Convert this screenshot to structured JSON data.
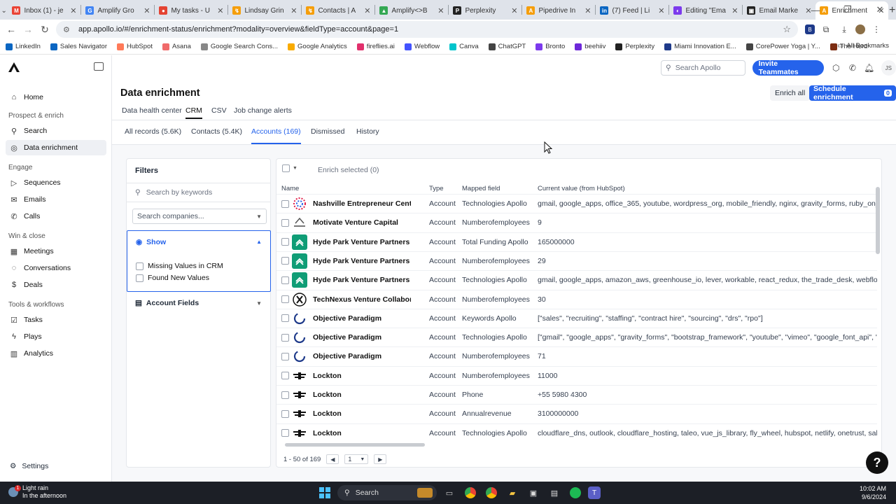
{
  "browser": {
    "tabs": [
      {
        "title": "Inbox (1) - je",
        "color": "#ea4335",
        "glyph": "M"
      },
      {
        "title": "Amplify Gro",
        "color": "#4285f4",
        "glyph": "G"
      },
      {
        "title": "My tasks - U",
        "color": "#e44332",
        "glyph": "●"
      },
      {
        "title": "Lindsay Grin",
        "color": "#f59e0b",
        "glyph": "↯"
      },
      {
        "title": "Contacts | A",
        "color": "#f59e0b",
        "glyph": "↯"
      },
      {
        "title": "Amplify<>B",
        "color": "#34a853",
        "glyph": "▲"
      },
      {
        "title": "Perplexity",
        "color": "#222",
        "glyph": "P"
      },
      {
        "title": "Pipedrive In",
        "color": "#f59e0b",
        "glyph": "A"
      },
      {
        "title": "(7) Feed | Li",
        "color": "#0a66c2",
        "glyph": "in"
      },
      {
        "title": "Editing \"Ema",
        "color": "#7c3aed",
        "glyph": "◐"
      },
      {
        "title": "Email Marke",
        "color": "#222",
        "glyph": "▣"
      },
      {
        "title": "Enrichment",
        "color": "#f59e0b",
        "glyph": "A"
      }
    ],
    "url": "app.apollo.io/#/enrichment-status/enrichment?modality=overview&fieldType=account&page=1",
    "bookmarks": [
      {
        "label": "LinkedIn",
        "color": "#0a66c2"
      },
      {
        "label": "Sales Navigator",
        "color": "#0a66c2"
      },
      {
        "label": "HubSpot",
        "color": "#ff7a59"
      },
      {
        "label": "Asana",
        "color": "#f06a6a"
      },
      {
        "label": "Google Search Cons...",
        "color": "#888888"
      },
      {
        "label": "Google Analytics",
        "color": "#f9ab00"
      },
      {
        "label": "fireflies.ai",
        "color": "#e1306c"
      },
      {
        "label": "Webflow",
        "color": "#4353ff"
      },
      {
        "label": "Canva",
        "color": "#00c4cc"
      },
      {
        "label": "ChatGPT",
        "color": "#444444"
      },
      {
        "label": "Bronto",
        "color": "#7c3aed"
      },
      {
        "label": "beehiiv",
        "color": "#6d28d9"
      },
      {
        "label": "Perplexity",
        "color": "#222222"
      },
      {
        "label": "Miami Innovation E...",
        "color": "#1e3a8a"
      },
      {
        "label": "CorePower Yoga | Y...",
        "color": "#444444"
      },
      {
        "label": "The Herd",
        "color": "#7c2d12"
      }
    ],
    "all_bookmarks": "All Bookmarks"
  },
  "sidebar": {
    "items": [
      {
        "label": "Home",
        "icon": "home-icon",
        "glyph": "⌂"
      },
      {
        "label": "Search",
        "icon": "search-icon",
        "glyph": "⚲"
      },
      {
        "label": "Data enrichment",
        "icon": "enrichment-icon",
        "glyph": "◎"
      },
      {
        "label": "Sequences",
        "icon": "sequences-icon",
        "glyph": "▷"
      },
      {
        "label": "Emails",
        "icon": "mail-icon",
        "glyph": "✉"
      },
      {
        "label": "Calls",
        "icon": "phone-icon",
        "glyph": "✆"
      },
      {
        "label": "Meetings",
        "icon": "calendar-icon",
        "glyph": "▦"
      },
      {
        "label": "Conversations",
        "icon": "chat-icon",
        "glyph": "◌"
      },
      {
        "label": "Deals",
        "icon": "dollar-icon",
        "glyph": "$"
      },
      {
        "label": "Tasks",
        "icon": "checkbox-icon",
        "glyph": "☑"
      },
      {
        "label": "Plays",
        "icon": "bolt-icon",
        "glyph": "ϟ"
      },
      {
        "label": "Analytics",
        "icon": "chart-icon",
        "glyph": "▥"
      }
    ],
    "sections": [
      "Prospect & enrich",
      "Engage",
      "Win & close",
      "Tools & workflows"
    ],
    "settings": "Settings"
  },
  "header": {
    "search_placeholder": "Search Apollo",
    "invite": "Invite Teammates",
    "avatar": "JS"
  },
  "page": {
    "title": "Data enrichment",
    "enrich_all": "Enrich all",
    "schedule": "Schedule enrichment",
    "schedule_badge": "0",
    "tabs": [
      "Data health center",
      "CRM",
      "CSV",
      "Job change alerts"
    ],
    "subtabs": [
      "All records (5.6K)",
      "Contacts (5.4K)",
      "Accounts (169)",
      "Dismissed",
      "History"
    ]
  },
  "filters": {
    "title": "Filters",
    "keyword_placeholder": "Search by keywords",
    "companies_placeholder": "Search companies...",
    "show_label": "Show",
    "options": [
      "Missing Values in CRM",
      "Found New Values"
    ],
    "account_fields": "Account Fields"
  },
  "table": {
    "enrich_selected": "Enrich selected (0)",
    "columns": [
      "Name",
      "Type",
      "Mapped field",
      "Current value (from HubSpot)"
    ],
    "rows": [
      {
        "name": "Nashville Entrepreneur Center",
        "type": "Account",
        "field": "Technologies Apollo",
        "value": "gmail, google_apps, office_365, youtube, wordpress_org, mobile_friendly, nginx, gravity_forms, ruby_on_rails, google_",
        "logo": "dots"
      },
      {
        "name": "Motivate Venture Capital",
        "type": "Account",
        "field": "Numberofemployees",
        "value": "9",
        "logo": "mvc"
      },
      {
        "name": "Hyde Park Venture Partners",
        "type": "Account",
        "field": "Total Funding Apollo",
        "value": "165000000",
        "logo": "hp"
      },
      {
        "name": "Hyde Park Venture Partners",
        "type": "Account",
        "field": "Numberofemployees",
        "value": "29",
        "logo": "hp"
      },
      {
        "name": "Hyde Park Venture Partners",
        "type": "Account",
        "field": "Technologies Apollo",
        "value": "gmail, google_apps, amazon_aws, greenhouse_io, lever, workable, react_redux, the_trade_desk, webflow, nginx, braint",
        "logo": "hp"
      },
      {
        "name": "TechNexus Venture Collabora...",
        "type": "Account",
        "field": "Numberofemployees",
        "value": "30",
        "logo": "x"
      },
      {
        "name": "Objective Paradigm",
        "type": "Account",
        "field": "Keywords Apollo",
        "value": "[\"sales\", \"recruiting\", \"staffing\", \"contract hire\", \"sourcing\", \"drs\", \"rpo\"]",
        "logo": "op"
      },
      {
        "name": "Objective Paradigm",
        "type": "Account",
        "field": "Technologies Apollo",
        "value": "[\"gmail\", \"google_apps\", \"gravity_forms\", \"bootstrap_framework\", \"youtube\", \"vimeo\", \"google_font_api\", \"google_tag",
        "logo": "op"
      },
      {
        "name": "Objective Paradigm",
        "type": "Account",
        "field": "Numberofemployees",
        "value": "71",
        "logo": "op"
      },
      {
        "name": "Lockton",
        "type": "Account",
        "field": "Numberofemployees",
        "value": "11000",
        "logo": "lk"
      },
      {
        "name": "Lockton",
        "type": "Account",
        "field": "Phone",
        "value": "+55 5980 4300",
        "logo": "lk"
      },
      {
        "name": "Lockton",
        "type": "Account",
        "field": "Annualrevenue",
        "value": "3100000000",
        "logo": "lk"
      },
      {
        "name": "Lockton",
        "type": "Account",
        "field": "Technologies Apollo",
        "value": "cloudflare_dns, outlook, cloudflare_hosting, taleo, vue_js_library, fly_wheel, hubspot, netlify, onetrust, salesforce, linke",
        "logo": "lk"
      }
    ],
    "pager_range": "1 - 50 of 169",
    "page": "1"
  },
  "taskbar": {
    "weather_title": "Light rain",
    "weather_sub": "In the afternoon",
    "search": "Search",
    "time": "10:02 AM",
    "date": "9/6/2024"
  }
}
